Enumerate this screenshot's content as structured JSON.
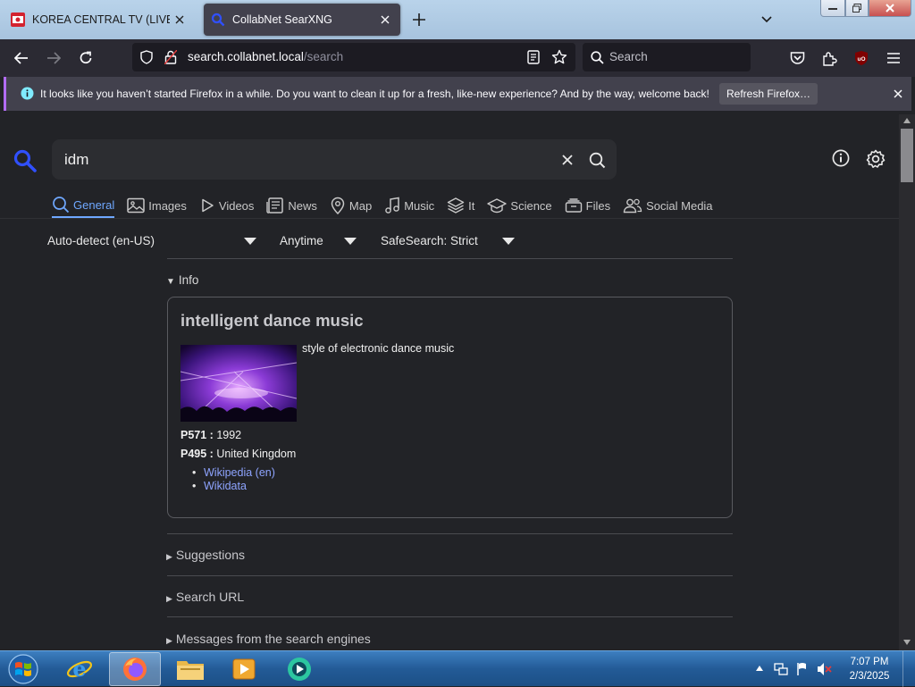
{
  "browser": {
    "tabs": [
      {
        "title": "KOREA CENTRAL TV (LIVESTRE",
        "active": false
      },
      {
        "title": "CollabNet SearXNG",
        "active": true
      }
    ],
    "url": {
      "host": "search.collabnet.local",
      "path": "/search"
    },
    "web_search_placeholder": "Search",
    "notification": {
      "message": "It looks like you haven’t started Firefox in a while. Do you want to clean it up for a fresh, like-new experience? And by the way, welcome back!",
      "button": "Refresh Firefox…"
    }
  },
  "search": {
    "query": "idm",
    "categories": [
      {
        "label": "General",
        "icon": "search-icon",
        "active": true
      },
      {
        "label": "Images",
        "icon": "image-icon"
      },
      {
        "label": "Videos",
        "icon": "play-icon"
      },
      {
        "label": "News",
        "icon": "newspaper-icon"
      },
      {
        "label": "Map",
        "icon": "map-pin-icon"
      },
      {
        "label": "Music",
        "icon": "music-note-icon"
      },
      {
        "label": "It",
        "icon": "layers-icon"
      },
      {
        "label": "Science",
        "icon": "school-icon"
      },
      {
        "label": "Files",
        "icon": "files-icon"
      },
      {
        "label": "Social Media",
        "icon": "people-icon"
      }
    ],
    "filters": {
      "language": "Auto-detect (en-US)",
      "time": "Anytime",
      "safesearch": "SafeSearch: Strict"
    }
  },
  "infobox": {
    "toggle": "Info",
    "title": "intelligent dance music",
    "description": "style of electronic dance music",
    "attributes": [
      {
        "key": "P571 :",
        "value": " 1992"
      },
      {
        "key": "P495 :",
        "value": " United Kingdom"
      }
    ],
    "links": [
      "Wikipedia (en)",
      "Wikidata"
    ]
  },
  "sections": [
    "Suggestions",
    "Search URL",
    "Messages from the search engines"
  ],
  "taskbar": {
    "time": "7:07 PM",
    "date": "2/3/2025"
  },
  "colors": {
    "accent": "#6fa8ff",
    "link": "#8ea4ff",
    "background": "#222327",
    "notification_accent": "#b36cf5"
  }
}
